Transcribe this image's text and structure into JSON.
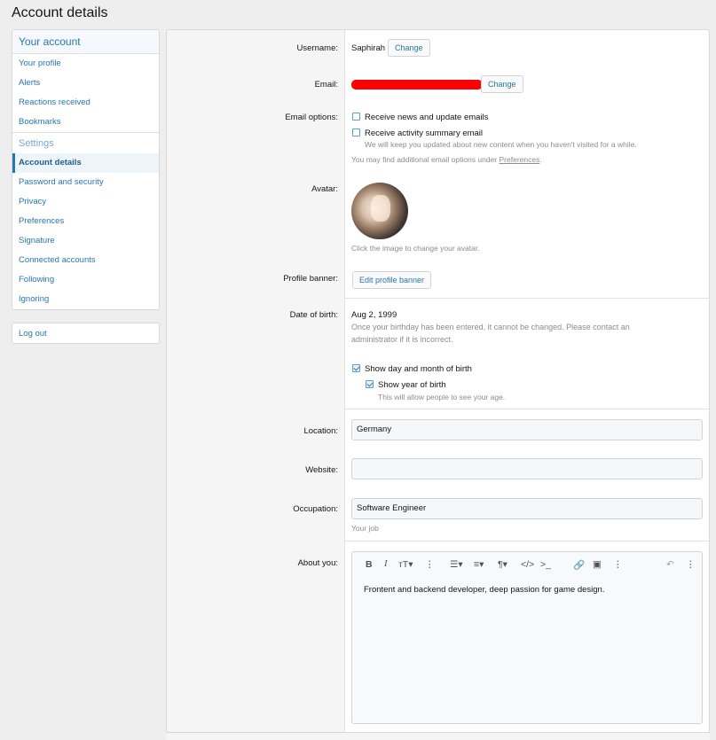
{
  "page": {
    "title": "Account details"
  },
  "sidebar": {
    "heading": "Your account",
    "items_top": [
      "Your profile",
      "Alerts",
      "Reactions received",
      "Bookmarks"
    ],
    "subheading": "Settings",
    "items_settings": [
      "Account details",
      "Password and security",
      "Privacy",
      "Preferences",
      "Signature",
      "Connected accounts",
      "Following",
      "Ignoring"
    ],
    "logout": "Log out"
  },
  "form": {
    "username_label": "Username:",
    "username_value": "Saphirah",
    "change_label": "Change",
    "email_label": "Email:",
    "email_options_label": "Email options:",
    "news_option": "Receive news and update emails",
    "summary_option": "Receive activity summary email",
    "summary_hint": "We will keep you updated about new content when you haven't visited for a while.",
    "more_options_prefix": "You may find additional email options under ",
    "more_options_link": "Preferences",
    "more_options_suffix": ".",
    "avatar_label": "Avatar:",
    "avatar_hint": "Click the image to change your avatar.",
    "banner_label": "Profile banner:",
    "banner_button": "Edit profile banner",
    "dob_label": "Date of birth:",
    "dob_value": "Aug 2, 1999",
    "dob_note_line1": "Once your birthday has been entered, it cannot be changed. Please contact an",
    "dob_note_line2": "administrator if it is incorrect.",
    "show_day_month": "Show day and month of birth",
    "show_year": "Show year of birth",
    "show_year_hint": "This will allow people to see your age.",
    "location_label": "Location:",
    "location_value": "Germany",
    "website_label": "Website:",
    "website_value": "",
    "occupation_label": "Occupation:",
    "occupation_value": "Software Engineer",
    "occupation_hint": "Your job",
    "about_label": "About you:",
    "about_value": "Frontent and backend developer, deep passion for game design."
  },
  "editor_toolbar": {
    "bold": "B",
    "italic": "I",
    "text_size": "тT▾",
    "more": "⋮",
    "list": "☰▾",
    "align": "≡▾",
    "paragraph": "¶▾",
    "code": "</>",
    "inline_code": ">_",
    "link": "🔗",
    "image": "▣",
    "more2": "⋮",
    "undo": "↶",
    "more3": "⋮"
  },
  "colors": {
    "accent": "#2577b1",
    "redaction": "#ff0000"
  }
}
